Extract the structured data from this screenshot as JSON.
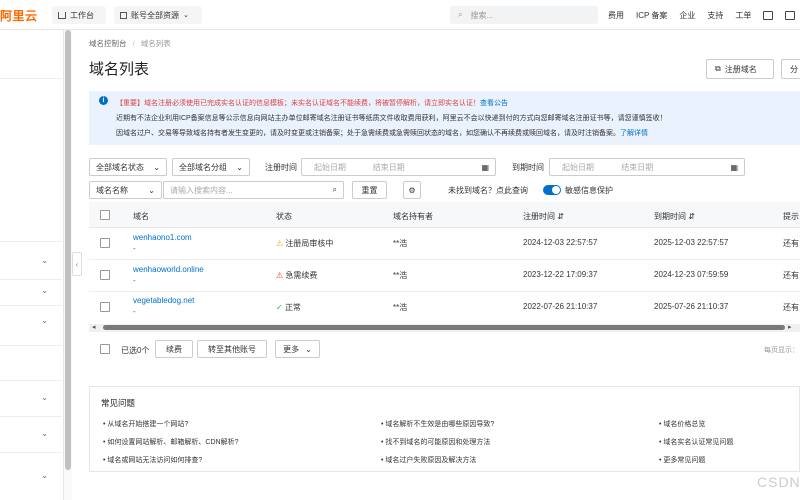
{
  "topbar": {
    "logo": "阿里云",
    "workbench": "工作台",
    "account": "账号全部资源",
    "search_placeholder": "搜索...",
    "nav": [
      "费用",
      "ICP 备案",
      "企业",
      "支持",
      "工单"
    ]
  },
  "breadcrumb": {
    "root": "域名控制台",
    "sep": "/",
    "current": "域名列表"
  },
  "page_title": "域名列表",
  "header_buttons": {
    "register": "注册域名",
    "more": "分"
  },
  "notice": {
    "line1_red": "【重要】域名注册必须使用已完成实名认证的信息模板；未实名认证域名不能续费，将被暂停解析，请立即实名认证！",
    "line1_link": "查看公告",
    "line2": "近期有不法企业利用ICP备案信息等公示信息向网站主办单位邮寄域名注册证书等纸质文件收取费用获利，阿里云不会以快递到付的方式向您邮寄域名注册证书等，请您谨慎签收！",
    "line3": "因域名过户、交易等导致域名持有者发生变更的，请及时变更或注销备案；处于急需续费或急需赎回状态的域名，如您确认不再续费或赎回域名，请及时注销备案。",
    "line3_link": "了解详情"
  },
  "filters": {
    "status": "全部域名状态",
    "group": "全部域名分组",
    "reg_time_label": "注册时间",
    "reg_start": "起始日期",
    "reg_end": "结束日期",
    "exp_time_label": "到期时间",
    "exp_start": "起始日期",
    "exp_end": "结束日期",
    "name_select": "域名名称",
    "search_placeholder": "请输入搜索内容...",
    "reset": "重置",
    "not_found": "未找到域名？点此查询",
    "privacy": "敏感信息保护"
  },
  "table": {
    "headers": [
      "域名",
      "状态",
      "域名持有者",
      "注册时间",
      "到期时间",
      "提示"
    ],
    "rows": [
      {
        "domain": "wenhaono1.com",
        "sub": "-",
        "status": "注册局审核中",
        "status_icon": "warning-icon",
        "owner": "**浩",
        "reg": "2024-12-03 22:57:57",
        "exp": "2025-12-03 22:57:57",
        "tip": "还有"
      },
      {
        "domain": "wenhaoworld.online",
        "sub": "-",
        "status": "急需续费",
        "status_icon": "alert-icon",
        "owner": "**浩",
        "reg": "2023-12-22 17:09:37",
        "exp": "2024-12-23 07:59:59",
        "tip": "还有"
      },
      {
        "domain": "vegetabledog.net",
        "sub": "-",
        "status": "正常",
        "status_icon": "check-icon",
        "owner": "**浩",
        "reg": "2022-07-26 21:10:37",
        "exp": "2025-07-26 21:10:37",
        "tip": "还有"
      }
    ]
  },
  "footer_bar": {
    "selected": "已选0个",
    "renew": "续费",
    "transfer": "转至其他账号",
    "more": "更多",
    "page_display": "每页显示："
  },
  "faq": {
    "title": "常见问题",
    "col1": [
      "从域名开始搭建一个网站?",
      "如何设置网站解析、邮箱解析、CDN解析?",
      "域名或网站无法访问如何排查?"
    ],
    "col2": [
      "域名解析不生效是由哪些原因导致?",
      "找不到域名的可能原因和处理方法",
      "域名过户失败原因及解决方法"
    ],
    "col3": [
      "域名价格总览",
      "域名实名认证常见问题",
      "更多常见问题"
    ]
  },
  "watermark": "CSDN",
  "colors": {
    "accent": "#0070cc",
    "brand": "#ff6a00",
    "danger": "#e04040",
    "warning": "#f5a623",
    "success": "#2faa3c"
  }
}
